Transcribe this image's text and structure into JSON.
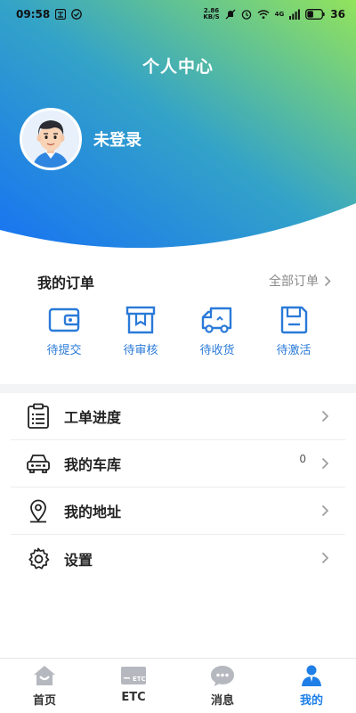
{
  "status_bar": {
    "time": "09:58",
    "net_speed_value": "2.86",
    "net_speed_unit": "KB/S",
    "network_label": "4G",
    "battery": "36"
  },
  "header": {
    "title": "个人中心",
    "login_status": "未登录"
  },
  "orders": {
    "title": "我的订单",
    "all_label": "全部订单",
    "items": [
      {
        "label": "待提交",
        "icon": "wallet-icon"
      },
      {
        "label": "待审核",
        "icon": "box-flag-icon"
      },
      {
        "label": "待收货",
        "icon": "truck-icon"
      },
      {
        "label": "待激活",
        "icon": "save-icon"
      }
    ]
  },
  "menu": [
    {
      "label": "工单进度",
      "icon": "clipboard-list-icon"
    },
    {
      "label": "我的车库",
      "icon": "car-icon",
      "count": "0"
    },
    {
      "label": "我的地址",
      "icon": "location-pin-icon"
    },
    {
      "label": "设置",
      "icon": "gear-icon"
    }
  ],
  "bottom_nav": [
    {
      "label": "首页",
      "icon": "home-icon"
    },
    {
      "label": "ETC",
      "icon": "etc-card-icon",
      "card_text": "ETC"
    },
    {
      "label": "消息",
      "icon": "message-icon"
    },
    {
      "label": "我的",
      "icon": "user-icon",
      "active": true
    }
  ],
  "colors": {
    "gradient_start": "#1a7ff0",
    "gradient_mid": "#3aa6c2",
    "gradient_end": "#8ee362",
    "accent": "#2a7ad8",
    "nav_active": "#1f7fe6"
  }
}
